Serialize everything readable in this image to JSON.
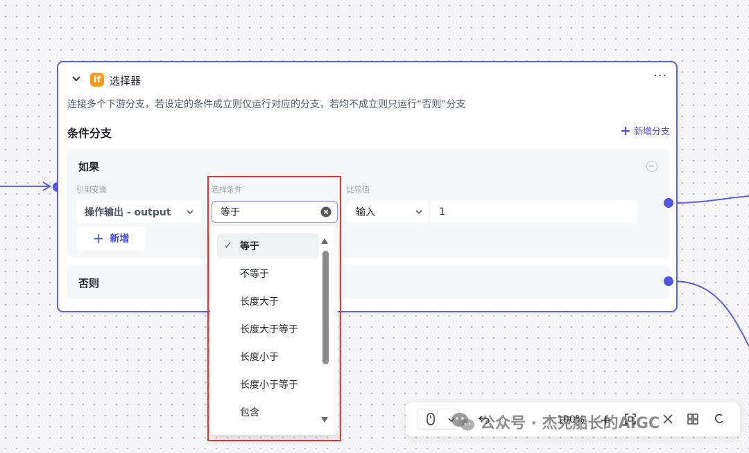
{
  "node": {
    "badge": "If",
    "title": "选择器",
    "more": "···",
    "description": "连接多个下游分支，若设定的条件成立则仅运行对应的分支，若均不成立则只运行“否则”分支",
    "section_title": "条件分支",
    "add_branch_label": "新增分支",
    "if_label": "如果",
    "else_label": "否则",
    "col_ref_var": "引用变量",
    "col_condition": "选择条件",
    "col_compare": "比较值",
    "ref_var_value": "操作输出 - output",
    "condition_value": "等于",
    "compare_type": "输入",
    "compare_value": "1",
    "add_condition_label": "新增"
  },
  "dropdown": {
    "options": [
      "等于",
      "不等于",
      "长度大于",
      "长度大于等于",
      "长度小于",
      "长度小于等于",
      "包含"
    ],
    "selected": "等于",
    "check": "✓"
  },
  "toolbar": {
    "zoom": "100%",
    "plus": "+"
  },
  "watermark": "公众号 · 杰克船长的AIGC",
  "colors": {
    "accent": "#5b5fe8",
    "badge": "#ff9a1f",
    "highlight_box": "#e8322c"
  }
}
